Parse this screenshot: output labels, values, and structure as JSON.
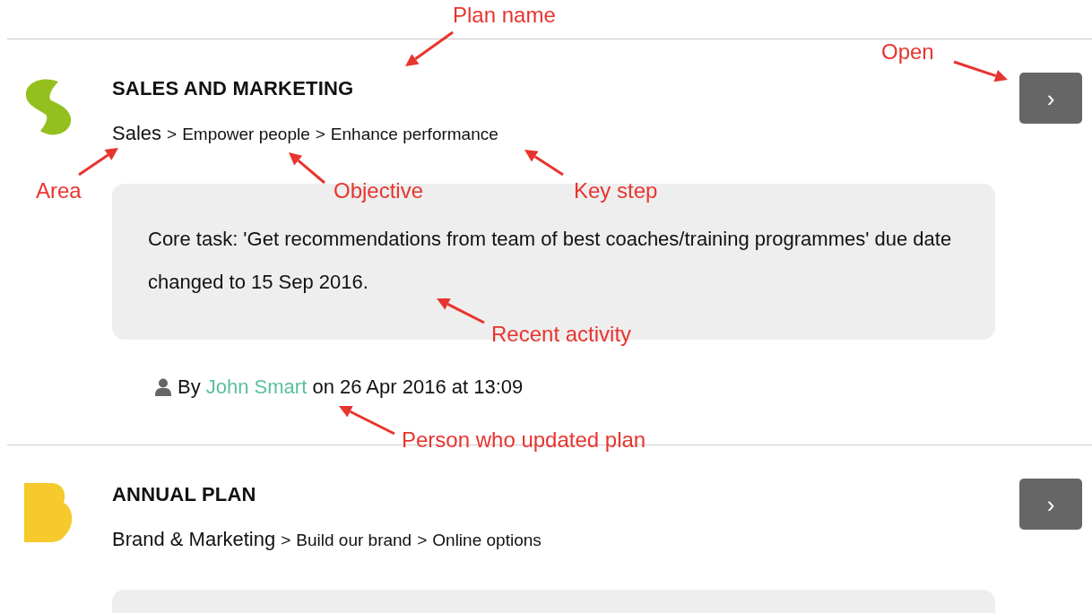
{
  "plans": [
    {
      "title": "SALES AND MARKETING",
      "logo": {
        "kind": "s-shape",
        "color": "#93c01f"
      },
      "path": [
        {
          "text": "Sales",
          "kind": "area"
        },
        {
          "text": ">",
          "kind": "separator"
        },
        {
          "text": "Empower people",
          "kind": "step"
        },
        {
          "text": ">",
          "kind": "separator"
        },
        {
          "text": "Enhance performance",
          "kind": "step"
        }
      ],
      "activity": "Core task: 'Get recommendations from team of best coaches/training programmes' due date changed to 15 Sep 2016.",
      "updated_by": {
        "prefix": "By",
        "author": "John Smart",
        "suffix": "on 26 Apr 2016 at 13:09"
      },
      "open_label": "›"
    },
    {
      "title": "ANNUAL PLAN",
      "logo": {
        "kind": "b-shape",
        "color": "#f6c92c"
      },
      "path": [
        {
          "text": "Brand & Marketing",
          "kind": "area"
        },
        {
          "text": ">",
          "kind": "separator"
        },
        {
          "text": "Build our brand",
          "kind": "step"
        },
        {
          "text": ">",
          "kind": "separator"
        },
        {
          "text": "Online options",
          "kind": "step"
        }
      ],
      "open_label": "›"
    }
  ],
  "annotations": [
    {
      "text": "Plan name"
    },
    {
      "text": "Open"
    },
    {
      "text": "Area"
    },
    {
      "text": "Objective"
    },
    {
      "text": "Key step"
    },
    {
      "text": "Recent activity"
    },
    {
      "text": "Person who updated plan"
    }
  ]
}
